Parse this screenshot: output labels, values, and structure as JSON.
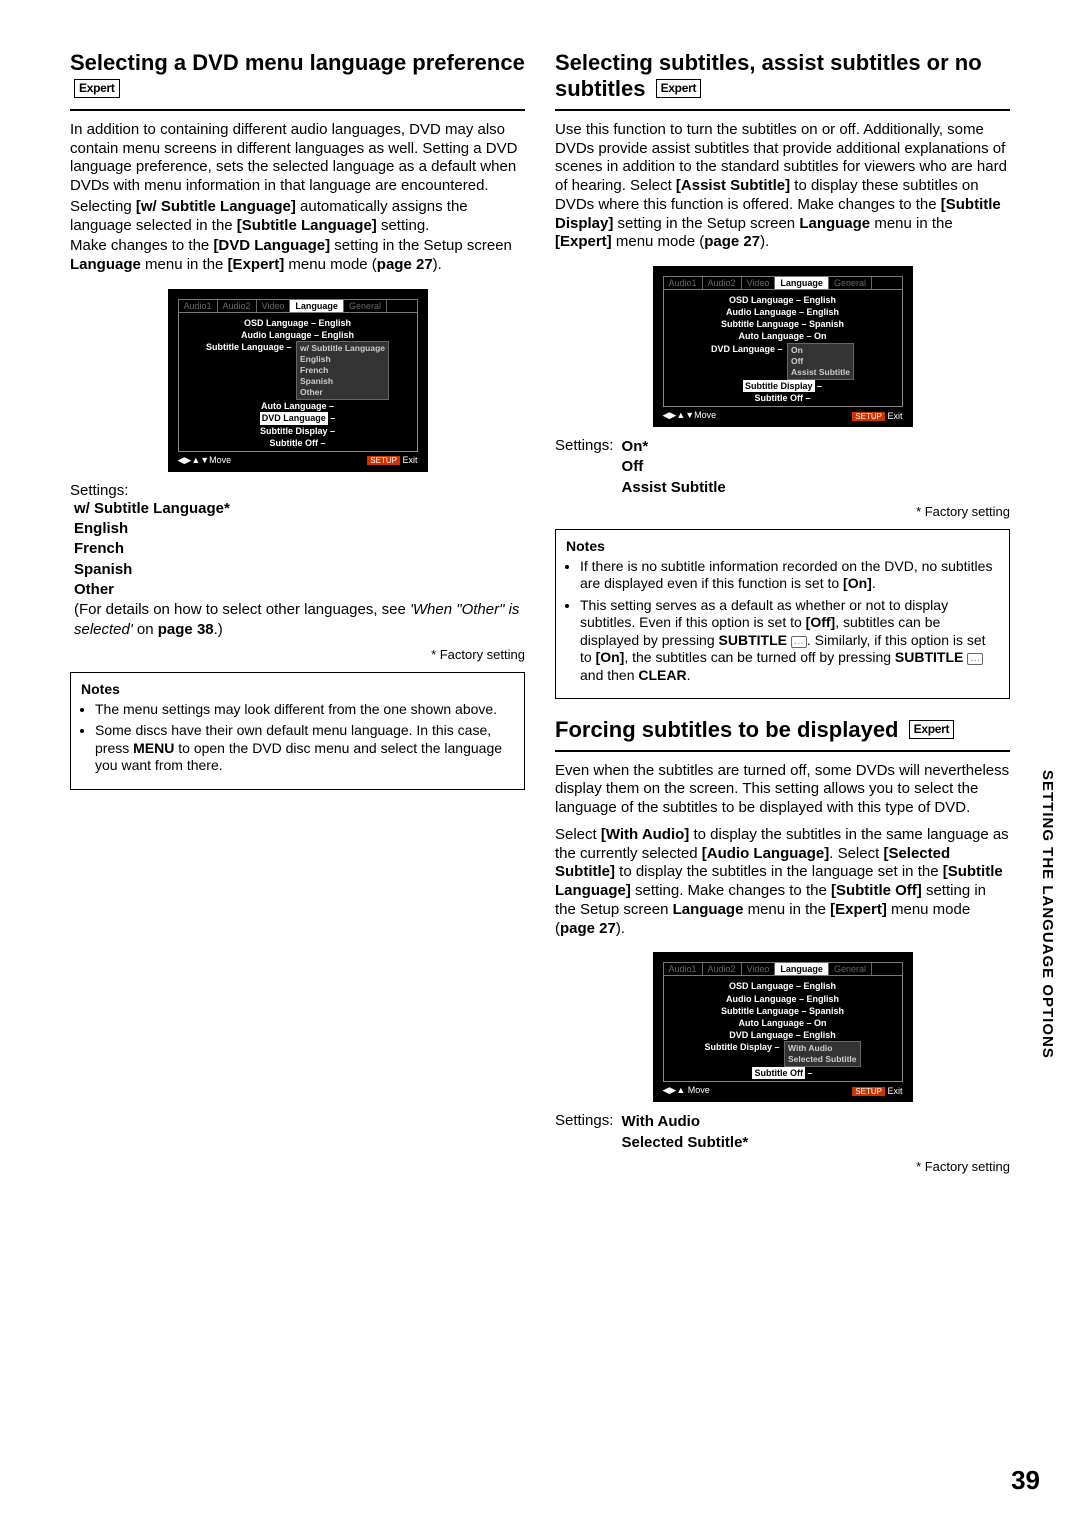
{
  "badges": {
    "expert": "Expert"
  },
  "side_text": "SETTING THE LANGUAGE OPTIONS",
  "page_number": "39",
  "factory_note": "* Factory setting",
  "left": {
    "title": "Selecting a DVD menu language preference",
    "p1a": "In addition to containing different audio languages, DVD may also contain menu screens in different languages as well. Setting a DVD language preference, sets the selected language as a default when DVDs with menu information in that language are encountered.",
    "p1b_pre": "Selecting ",
    "p1b_b1": "[w/ Subtitle Language]",
    "p1b_mid": " automatically assigns the language selected in the ",
    "p1b_b2": "[Subtitle Language]",
    "p1b_post": " setting.",
    "p1c_pre": "Make changes to the ",
    "p1c_b1": "[DVD Language]",
    "p1c_mid": " setting in the Setup screen ",
    "p1c_b2": "Language",
    "p1c_mid2": " menu in the ",
    "p1c_b3": "[Expert]",
    "p1c_post": " menu mode (",
    "p1c_pg": "page 27",
    "p1c_end": ").",
    "osd": {
      "tabs": [
        "Audio1",
        "Audio2",
        "Video",
        "Language",
        "General"
      ],
      "activeTab": "Language",
      "rows": [
        {
          "l": "OSD Language",
          "v": "English"
        },
        {
          "l": "Audio Language",
          "v": "English"
        },
        {
          "l": "Subtitle Language",
          "v": "w/ Subtitle Language"
        },
        {
          "l": "Auto Language",
          "v": "English"
        },
        {
          "l": "DVD Language",
          "v": "French",
          "hl": true
        },
        {
          "l": "Subtitle Display",
          "v": "Spanish"
        },
        {
          "l": "Subtitle Off",
          "v": "Other"
        }
      ],
      "move": "Move",
      "setup": "SETUP",
      "exit": "Exit"
    },
    "settings_label": "Settings:",
    "opts": [
      "w/ Subtitle Language*",
      "English",
      "French",
      "Spanish",
      "Other"
    ],
    "opts_extra_pre": "(For details on how to select other languages, see ",
    "opts_extra_i": "'When \"Other\" is selected'",
    "opts_extra_mid": " on ",
    "opts_extra_pg": "page 38",
    "opts_extra_end": ".)",
    "notes_h": "Notes",
    "notes": [
      "The menu settings may look different from the one shown above.",
      "Some discs have their own default menu language. In this case, press <b>MENU</b> to open the DVD disc menu and select the language you want from there."
    ]
  },
  "right1": {
    "title": "Selecting subtitles, assist subtitles or no subtitles",
    "p_pre": "Use this function to turn the subtitles on or off. Additionally, some DVDs provide assist subtitles that provide additional explanations of scenes in addition to the standard subtitles for viewers who are hard of hearing. Select ",
    "p_b1": "[Assist Subtitle]",
    "p_mid": " to display these subtitles on DVDs where this function is offered. Make changes to the ",
    "p_b2": "[Subtitle Display]",
    "p_mid2": " setting in the Setup screen ",
    "p_b3": "Language",
    "p_mid3": " menu in the ",
    "p_b4": "[Expert]",
    "p_post": " menu mode (",
    "p_pg": "page 27",
    "p_end": ").",
    "osd": {
      "tabs": [
        "Audio1",
        "Audio2",
        "Video",
        "Language",
        "General"
      ],
      "rows": [
        {
          "l": "OSD Language",
          "v": "English"
        },
        {
          "l": "Audio Language",
          "v": "English"
        },
        {
          "l": "Subtitle Language",
          "v": "Spanish"
        },
        {
          "l": "Auto Language",
          "v": "On"
        },
        {
          "l": "DVD Language",
          "v": "On"
        },
        {
          "l": "Subtitle Display",
          "v": "Off",
          "hl": true
        },
        {
          "l": "Subtitle Off",
          "v": "Assist Subtitle"
        }
      ],
      "move": "Move",
      "setup": "SETUP",
      "exit": "Exit"
    },
    "settings_label": "Settings:",
    "opts": [
      "On*",
      "Off",
      "Assist Subtitle"
    ],
    "notes_h": "Notes",
    "notes": [
      "If there is no subtitle information recorded on the DVD, no subtitles are displayed even if this function is set to <b>[On]</b>.",
      "This setting serves as a default as whether or not to display subtitles. Even if this option is set to <b>[Off]</b>, subtitles can be displayed by pressing <b>SUBTITLE</b> <span class=\"subbtn\">…</span>. Similarly, if this option is set to <b>[On]</b>, the subtitles can be turned off by pressing <b>SUBTITLE</b> <span class=\"subbtn\">…</span> and then <b>CLEAR</b>."
    ]
  },
  "right2": {
    "title": "Forcing subtitles to be displayed",
    "p1": "Even when the subtitles are turned off, some DVDs will nevertheless display them on the screen. This setting allows you to select the language of the subtitles to be displayed with this type of DVD.",
    "p2_pre": "Select ",
    "p2_b1": "[With Audio]",
    "p2_mid": " to display the subtitles in the same language as the currently selected ",
    "p2_b2": "[Audio Language]",
    "p2_mid2": ". Select ",
    "p2_b3": "[Selected Subtitle]",
    "p2_mid3": " to display the subtitles in the language set in the ",
    "p2_b4": "[Subtitle Language]",
    "p2_mid4": " setting. Make changes to the ",
    "p2_b5": "[Subtitle Off]",
    "p2_mid5": " setting in the Setup screen ",
    "p2_b6": "Language",
    "p2_mid6": " menu in the ",
    "p2_b7": "[Expert]",
    "p2_post": " menu mode (",
    "p2_pg": "page 27",
    "p2_end": ").",
    "osd": {
      "tabs": [
        "Audio1",
        "Audio2",
        "Video",
        "Language",
        "General"
      ],
      "rows": [
        {
          "l": "OSD Language",
          "v": "English"
        },
        {
          "l": "Audio Language",
          "v": "English"
        },
        {
          "l": "Subtitle Language",
          "v": "Spanish"
        },
        {
          "l": "Auto Language",
          "v": "On"
        },
        {
          "l": "DVD Language",
          "v": "English"
        },
        {
          "l": "Subtitle Display",
          "v": "With Audio"
        },
        {
          "l": "Subtitle Off",
          "v": "Selected Subtitle",
          "hl": true
        }
      ],
      "move": "Move",
      "setup": "SETUP",
      "exit": "Exit"
    },
    "settings_label": "Settings:",
    "opts": [
      "With Audio",
      "Selected Subtitle*"
    ]
  }
}
